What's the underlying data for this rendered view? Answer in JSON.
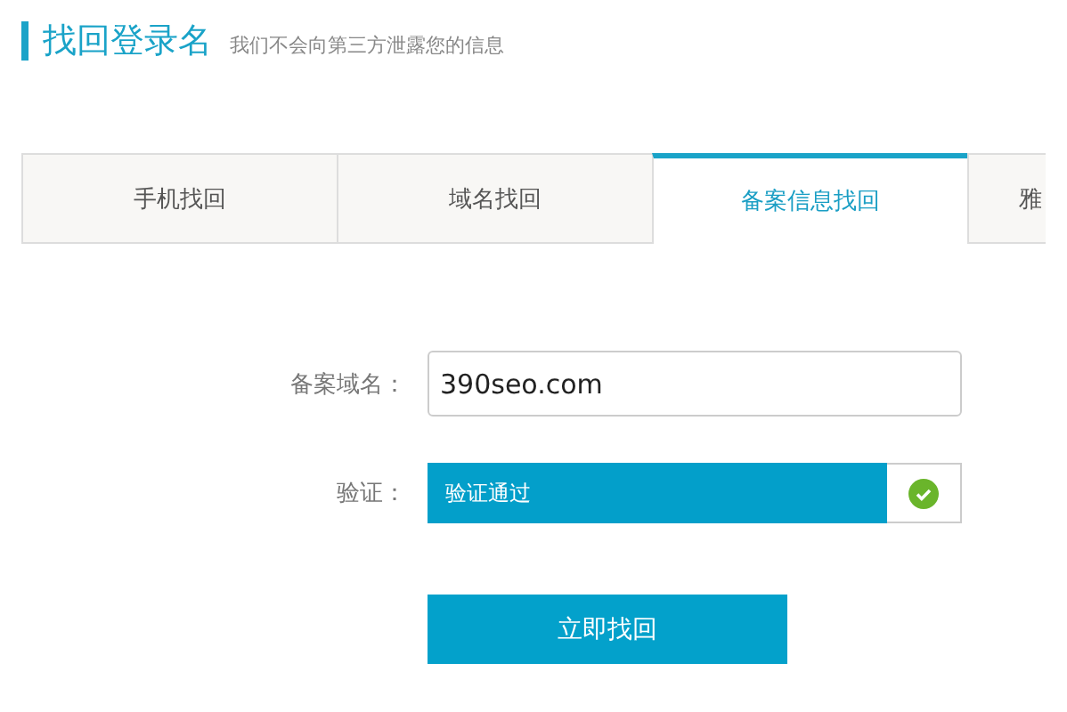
{
  "header": {
    "title": "找回登录名",
    "subtitle": "我们不会向第三方泄露您的信息"
  },
  "tabs": [
    {
      "label": "手机找回",
      "selected": false
    },
    {
      "label": "域名找回",
      "selected": false
    },
    {
      "label": "备案信息找回",
      "selected": true
    },
    {
      "label": "雅",
      "selected": false
    }
  ],
  "form": {
    "domain_label": "备案域名：",
    "domain_value": "390seo.com",
    "verify_label": "验证：",
    "verify_text": "验证通过",
    "verified": true
  },
  "submit": "立即找回"
}
